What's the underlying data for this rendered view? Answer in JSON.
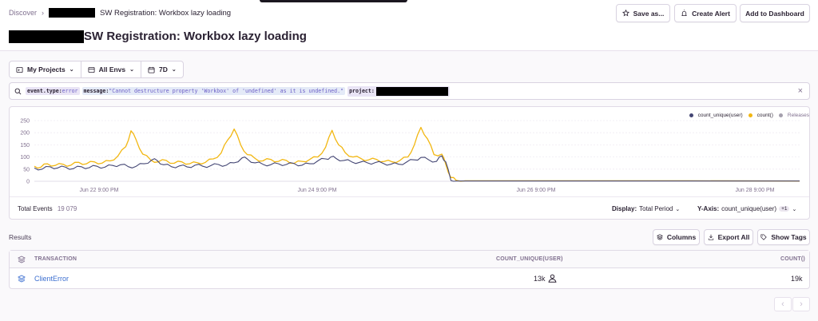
{
  "breadcrumb": {
    "root": "Discover",
    "separator": "›",
    "title": "SW Registration: Workbox lazy loading"
  },
  "header": {
    "title": "SW Registration: Workbox lazy loading",
    "save_label": "Save as...",
    "alert_label": "Create Alert",
    "dashboard_label": "Add to Dashboard"
  },
  "filters": {
    "projects": "My Projects",
    "envs": "All Envs",
    "period": "7D"
  },
  "search": {
    "tokens": [
      {
        "key": "event.type:",
        "value": "error"
      },
      {
        "key": "message:",
        "value": "\"Cannot destructure property 'Workbox' of 'undefined' as it is undefined.\""
      },
      {
        "key": "project:",
        "value": ""
      }
    ]
  },
  "chart_data": {
    "type": "line",
    "y_ticks": [
      "250",
      "200",
      "150",
      "100",
      "50",
      "0"
    ],
    "ylim": [
      0,
      250
    ],
    "x_ticks": [
      "Jun 22 9:00 PM",
      "Jun 24 9:00 PM",
      "Jun 26 9:00 PM",
      "Jun 28 9:00 PM"
    ],
    "legend": [
      "count_unique(user)",
      "count()",
      "Releases"
    ],
    "legend_position": "top-right",
    "colors": {
      "count_unique": "#444674",
      "count": "#f2b712",
      "releases": "#a5a0ad"
    },
    "series": [
      {
        "name": "count_unique(user)",
        "points": [
          [
            0,
            55
          ],
          [
            0.6,
            50
          ],
          [
            1.2,
            60
          ],
          [
            1.8,
            55
          ],
          [
            2.4,
            58
          ],
          [
            3,
            52
          ],
          [
            3.6,
            60
          ],
          [
            4.2,
            56
          ],
          [
            4.8,
            62
          ],
          [
            5.4,
            58
          ],
          [
            6,
            65
          ],
          [
            6.6,
            68
          ],
          [
            7.2,
            60
          ],
          [
            7.8,
            62
          ],
          [
            8.4,
            72
          ],
          [
            9,
            88
          ],
          [
            9.4,
            86
          ],
          [
            9.9,
            68
          ],
          [
            10.5,
            60
          ],
          [
            11.1,
            63
          ],
          [
            11.7,
            59
          ],
          [
            12.3,
            66
          ],
          [
            12.9,
            62
          ],
          [
            13.5,
            64
          ],
          [
            14.1,
            69
          ],
          [
            14.7,
            66
          ],
          [
            15.3,
            76
          ],
          [
            15.9,
            96
          ],
          [
            16.3,
            92
          ],
          [
            16.9,
            76
          ],
          [
            17.5,
            70
          ],
          [
            18.1,
            68
          ],
          [
            18.7,
            72
          ],
          [
            19.3,
            69
          ],
          [
            19.9,
            73
          ],
          [
            20.5,
            66
          ],
          [
            21.1,
            72
          ],
          [
            21.7,
            84
          ],
          [
            22.3,
            92
          ],
          [
            22.7,
            100
          ],
          [
            23.1,
            94
          ],
          [
            23.7,
            86
          ],
          [
            24.3,
            80
          ],
          [
            24.9,
            78
          ],
          [
            25.5,
            76
          ],
          [
            26.1,
            77
          ],
          [
            26.7,
            74
          ],
          [
            27.3,
            70
          ],
          [
            27.9,
            70
          ],
          [
            28.5,
            79
          ],
          [
            29.1,
            88
          ],
          [
            29.6,
            98
          ],
          [
            30.2,
            88
          ],
          [
            30.8,
            82
          ],
          [
            31.2,
            105
          ],
          [
            31.5,
            80
          ],
          [
            31.9,
            3
          ],
          [
            32.3,
            1
          ],
          [
            40,
            1
          ],
          [
            50,
            1
          ],
          [
            58.6,
            1
          ]
        ]
      },
      {
        "name": "count()",
        "points": [
          [
            0,
            62
          ],
          [
            0.5,
            58
          ],
          [
            1,
            72
          ],
          [
            1.6,
            65
          ],
          [
            2.2,
            70
          ],
          [
            2.8,
            66
          ],
          [
            3.4,
            78
          ],
          [
            4,
            72
          ],
          [
            4.6,
            80
          ],
          [
            5.2,
            75
          ],
          [
            5.8,
            84
          ],
          [
            6.4,
            104
          ],
          [
            7,
            142
          ],
          [
            7.4,
            208
          ],
          [
            7.8,
            170
          ],
          [
            8.3,
            112
          ],
          [
            8.9,
            88
          ],
          [
            9.5,
            80
          ],
          [
            10.1,
            86
          ],
          [
            10.7,
            74
          ],
          [
            11.3,
            80
          ],
          [
            11.9,
            72
          ],
          [
            12.5,
            76
          ],
          [
            13.1,
            78
          ],
          [
            13.7,
            92
          ],
          [
            14.3,
            116
          ],
          [
            14.8,
            170
          ],
          [
            15.3,
            215
          ],
          [
            15.8,
            150
          ],
          [
            16.3,
            110
          ],
          [
            16.9,
            94
          ],
          [
            17.5,
            84
          ],
          [
            18.1,
            90
          ],
          [
            18.7,
            82
          ],
          [
            19.3,
            86
          ],
          [
            19.9,
            74
          ],
          [
            20.5,
            82
          ],
          [
            21.1,
            90
          ],
          [
            21.7,
            100
          ],
          [
            22.3,
            140
          ],
          [
            22.8,
            210
          ],
          [
            23.3,
            150
          ],
          [
            23.8,
            118
          ],
          [
            24.4,
            100
          ],
          [
            25,
            94
          ],
          [
            25.6,
            88
          ],
          [
            26.2,
            90
          ],
          [
            26.8,
            82
          ],
          [
            27.4,
            80
          ],
          [
            28,
            86
          ],
          [
            28.6,
            100
          ],
          [
            29.1,
            150
          ],
          [
            29.6,
            222
          ],
          [
            30.1,
            175
          ],
          [
            30.6,
            110
          ],
          [
            31.2,
            112
          ],
          [
            31.5,
            70
          ],
          [
            31.9,
            15
          ],
          [
            32.3,
            4
          ],
          [
            33,
            2
          ],
          [
            40,
            2
          ],
          [
            50,
            2
          ],
          [
            58.6,
            1
          ]
        ]
      }
    ]
  },
  "chart_footer": {
    "total_label": "Total Events",
    "total_value": "19 079",
    "display_label": "Display:",
    "display_value": "Total Period",
    "yaxis_label": "Y-Axis:",
    "yaxis_value": "count_unique(user)",
    "yaxis_extra": "+1"
  },
  "results": {
    "label": "Results",
    "columns_label": "Columns",
    "export_label": "Export All",
    "tags_label": "Show Tags",
    "headers": [
      "TRANSACTION",
      "COUNT_UNIQUE(USER)",
      "COUNT()"
    ],
    "rows": [
      {
        "transaction": "ClientError",
        "count_unique": "13k",
        "count": "19k"
      }
    ]
  },
  "pagination": {
    "prev": "‹",
    "next": "›"
  }
}
